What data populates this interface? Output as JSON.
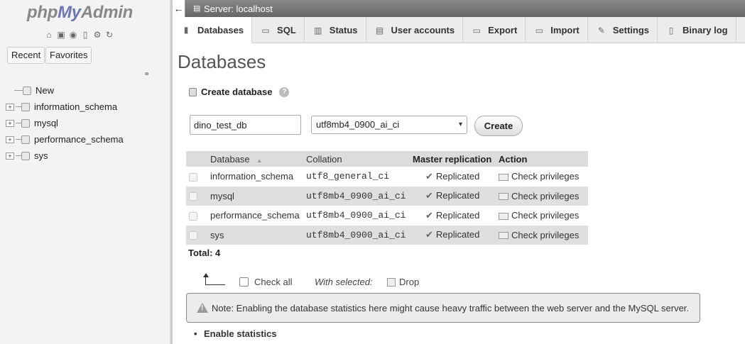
{
  "nav": {
    "logo_php": "php",
    "logo_my": "My",
    "logo_admin": "Admin",
    "recent_label": "Recent",
    "favorites_label": "Favorites",
    "tree": [
      {
        "label": "New",
        "expandable": false
      },
      {
        "label": "information_schema",
        "expandable": true
      },
      {
        "label": "mysql",
        "expandable": true
      },
      {
        "label": "performance_schema",
        "expandable": true
      },
      {
        "label": "sys",
        "expandable": true
      }
    ]
  },
  "topbar": {
    "collapse_glyph": "←",
    "breadcrumb": "Server: localhost"
  },
  "tabs": [
    {
      "label": "Databases",
      "icon": "databases-icon",
      "active": true
    },
    {
      "label": "SQL",
      "icon": "sql-icon"
    },
    {
      "label": "Status",
      "icon": "status-icon"
    },
    {
      "label": "User accounts",
      "icon": "users-icon"
    },
    {
      "label": "Export",
      "icon": "export-icon"
    },
    {
      "label": "Import",
      "icon": "import-icon"
    },
    {
      "label": "Settings",
      "icon": "wrench-icon"
    },
    {
      "label": "Binary log",
      "icon": "binlog-icon"
    }
  ],
  "main": {
    "title": "Databases",
    "create_heading": "Create database",
    "db_name_value": "dino_test_db",
    "collation_selected": "utf8mb4_0900_ai_ci",
    "create_button": "Create",
    "table": {
      "headers": {
        "database": "Database",
        "collation": "Collation",
        "replication": "Master replication",
        "action": "Action"
      },
      "rows": [
        {
          "name": "information_schema",
          "collation": "utf8_general_ci",
          "replication": "Replicated",
          "action": "Check privileges"
        },
        {
          "name": "mysql",
          "collation": "utf8mb4_0900_ai_ci",
          "replication": "Replicated",
          "action": "Check privileges"
        },
        {
          "name": "performance_schema",
          "collation": "utf8mb4_0900_ai_ci",
          "replication": "Replicated",
          "action": "Check privileges"
        },
        {
          "name": "sys",
          "collation": "utf8mb4_0900_ai_ci",
          "replication": "Replicated",
          "action": "Check privileges"
        }
      ]
    },
    "total": "Total: 4",
    "check_all": "Check all",
    "with_selected": "With selected:",
    "drop": "Drop",
    "notice": "Note: Enabling the database statistics here might cause heavy traffic between the web server and the MySQL server.",
    "enable_stats": "Enable statistics"
  }
}
